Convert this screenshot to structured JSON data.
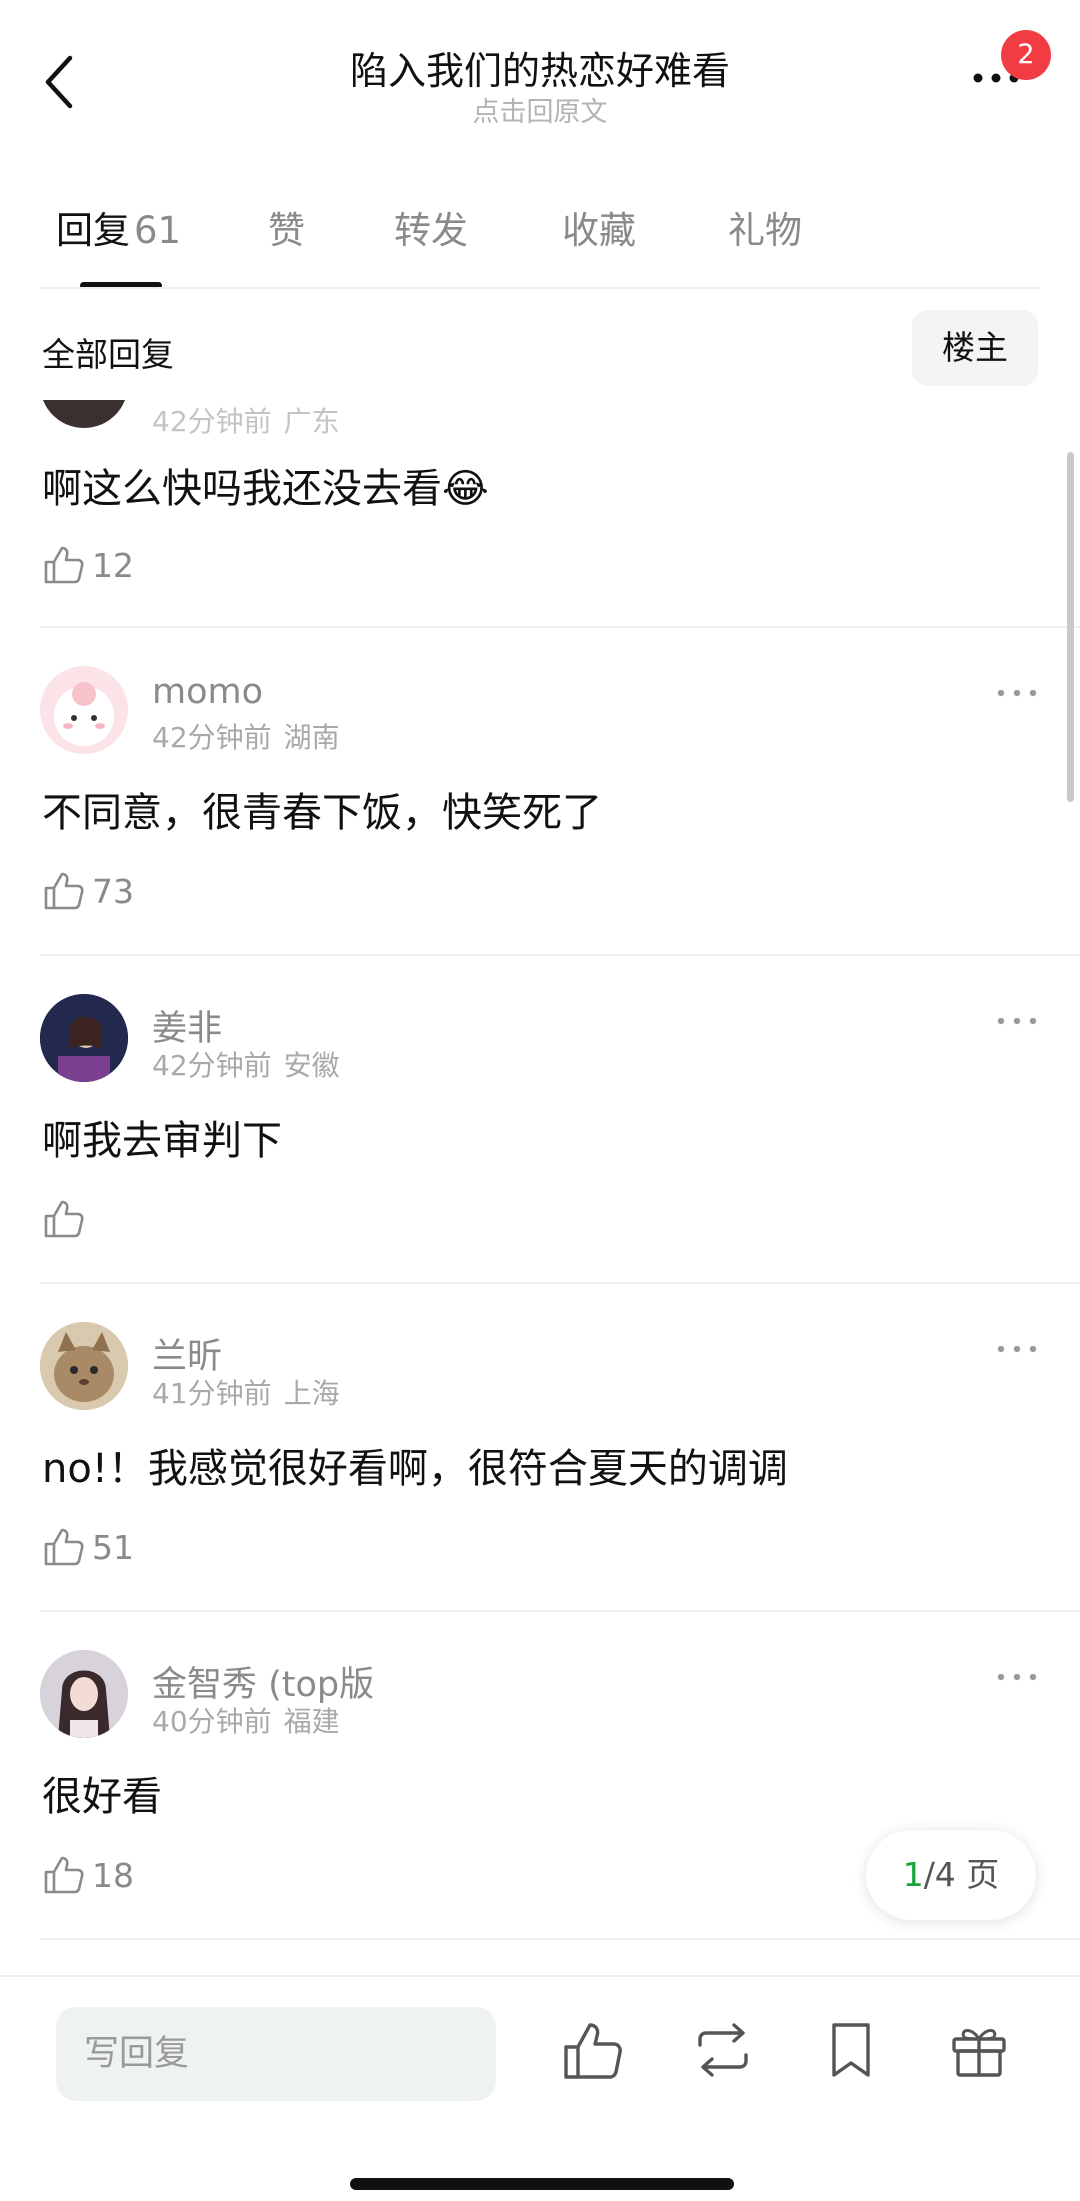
{
  "header": {
    "title": "陷入我们的热恋好难看",
    "subtitle": "点击回原文",
    "badge_count": "2"
  },
  "tabs": [
    {
      "label": "回复",
      "count": "61",
      "active": true
    },
    {
      "label": "赞",
      "count": ""
    },
    {
      "label": "转发",
      "count": ""
    },
    {
      "label": "收藏",
      "count": ""
    },
    {
      "label": "礼物",
      "count": ""
    }
  ],
  "section": {
    "title": "全部回复",
    "op_button": "楼主"
  },
  "comments": [
    {
      "name": "",
      "time": "42分钟前",
      "location": "广东",
      "text": "啊这么快吗我还没去看😂",
      "likes": "12"
    },
    {
      "name": "momo",
      "time": "42分钟前",
      "location": "湖南",
      "text": "不同意，很青春下饭，快笑死了",
      "likes": "73"
    },
    {
      "name": "姜非",
      "time": "42分钟前",
      "location": "安徽",
      "text": "啊我去审判下",
      "likes": ""
    },
    {
      "name": "兰昕",
      "time": "41分钟前",
      "location": "上海",
      "text": "no!！我感觉很好看啊，很符合夏天的调调",
      "likes": "51"
    },
    {
      "name": "金智秀 (top版",
      "time": "40分钟前",
      "location": "福建",
      "text": "很好看",
      "likes": "18"
    }
  ],
  "pager": {
    "current": "1",
    "total_text": "/4 页"
  },
  "bottom_bar": {
    "reply_placeholder": "写回复",
    "icons": [
      "like-icon",
      "repost-icon",
      "bookmark-icon",
      "gift-icon"
    ]
  },
  "colors": {
    "badge": "#f23c44",
    "pager_current": "#1aa33a",
    "reply_input_bg": "#eef3f0"
  }
}
